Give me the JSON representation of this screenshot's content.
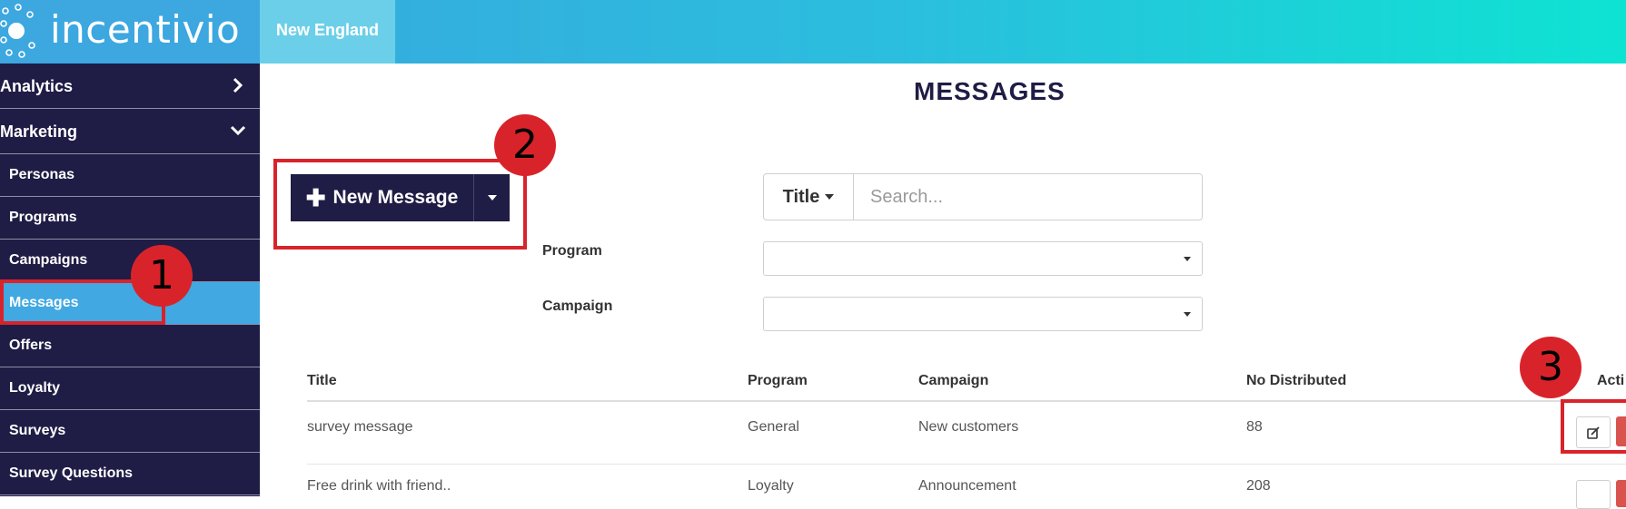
{
  "header": {
    "logo_text": "incentivio",
    "region_tab": "New England",
    "colors": {
      "brand_dark": "#1f1d45",
      "brand_blue": "#3da7e0",
      "accent_teal": "#0ee3d2",
      "annotation_red": "#d9232b"
    }
  },
  "sidebar": {
    "items": [
      {
        "label": "Analytics",
        "icon": "chevron-right-icon"
      },
      {
        "label": "Marketing",
        "icon": "chevron-down-icon"
      },
      {
        "label": "Personas"
      },
      {
        "label": "Programs"
      },
      {
        "label": "Campaigns"
      },
      {
        "label": "Messages",
        "active": true
      },
      {
        "label": "Offers"
      },
      {
        "label": "Loyalty"
      },
      {
        "label": "Surveys"
      },
      {
        "label": "Survey Questions"
      }
    ]
  },
  "main": {
    "title": "MESSAGES",
    "new_message_label": "New Message",
    "search": {
      "type_label": "Title",
      "placeholder": "Search..."
    },
    "filters": {
      "program_label": "Program",
      "campaign_label": "Campaign"
    }
  },
  "table": {
    "headers": [
      "Title",
      "Program",
      "Campaign",
      "No Distributed",
      "Acti"
    ],
    "rows": [
      {
        "title": "survey message",
        "program": "General",
        "campaign": "New customers",
        "distributed": "88"
      },
      {
        "title": "Free drink with friend..",
        "program": "Loyalty",
        "campaign": "Announcement",
        "distributed": "208"
      }
    ]
  },
  "annotations": [
    "1",
    "2",
    "3"
  ]
}
